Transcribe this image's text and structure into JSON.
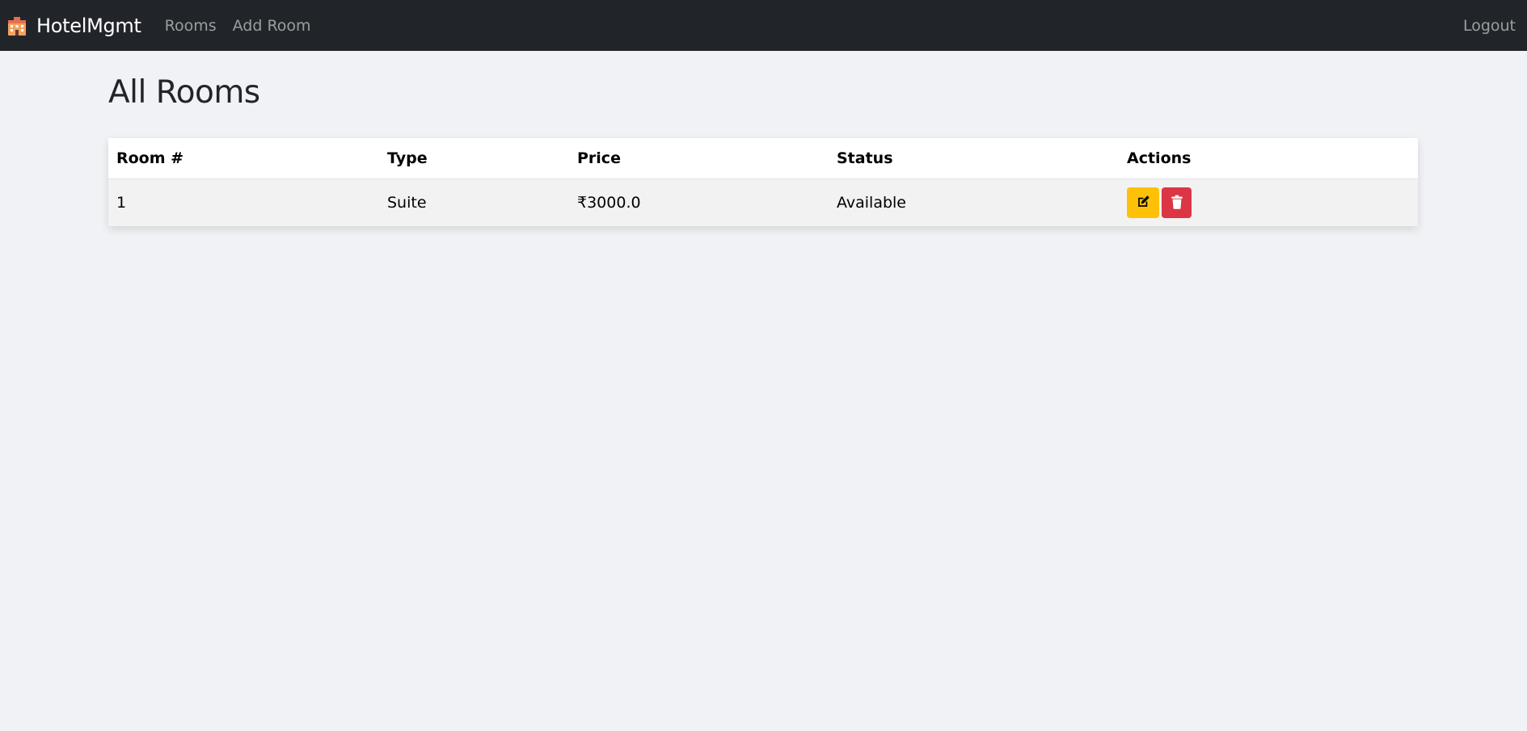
{
  "navbar": {
    "brand_icon": "hotel-icon",
    "brand_text": "HotelMgmt",
    "links": [
      {
        "label": "Rooms"
      },
      {
        "label": "Add Room"
      }
    ],
    "logout_label": "Logout",
    "background": "#212529"
  },
  "page": {
    "title": "All Rooms"
  },
  "table": {
    "headers": [
      "Room #",
      "Type",
      "Price",
      "Status",
      "Actions"
    ],
    "rows": [
      {
        "room_number": "1",
        "type": "Suite",
        "price": "₹3000.0",
        "status": "Available",
        "actions": [
          {
            "icon": "edit-icon",
            "color": "#ffc107"
          },
          {
            "icon": "trash-icon",
            "color": "#dc3545"
          }
        ]
      }
    ]
  }
}
